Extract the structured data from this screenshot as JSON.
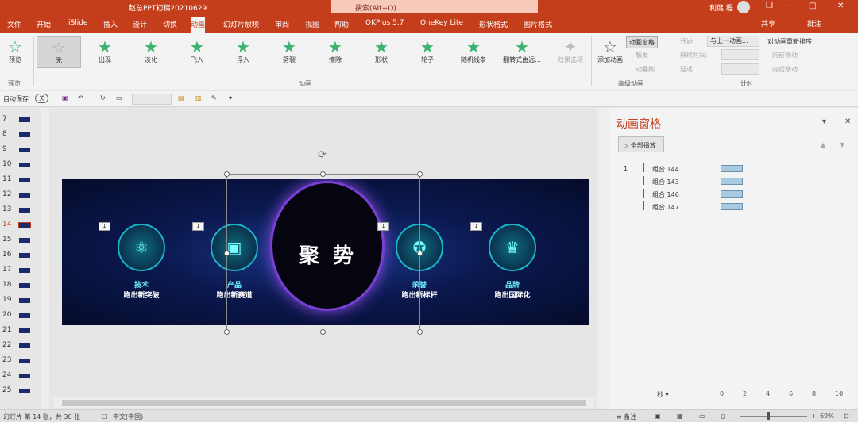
{
  "title_bar": {
    "document": "赵总PPT初稿20210629",
    "search_placeholder": "搜索(Alt+Q)",
    "user": "利健 程",
    "minimize": "—",
    "restore": "❐",
    "maximize": "□",
    "close": "✕"
  },
  "tabs": [
    "文件",
    "开始",
    "iSlide",
    "插入",
    "设计",
    "切换",
    "动画",
    "幻灯片放映",
    "审阅",
    "视图",
    "帮助",
    "OKPlus 5.7",
    "OneKey Lite",
    "形状格式",
    "图片格式"
  ],
  "active_tab": "动画",
  "share": "共享",
  "comments": "批注",
  "ribbon": {
    "preview": "预览",
    "preview_group": "预览",
    "animations": [
      "无",
      "出现",
      "淡化",
      "飞入",
      "浮入",
      "劈裂",
      "擦除",
      "形状",
      "轮子",
      "随机线条",
      "翻转式由远..."
    ],
    "selected_animation": "无",
    "effect_options": "效果选项",
    "animation_group": "动画",
    "add_animation": "添加动画",
    "animation_pane": "动画窗格",
    "trigger": "触发",
    "animation_painter": "动画刷",
    "advanced_group": "高级动画",
    "start_label": "开始:",
    "start_value": "与上一动画...",
    "duration_label": "持续时间:",
    "delay_label": "延迟:",
    "reorder": "对动画重新排序",
    "move_earlier": "向前移动",
    "move_later": "向后移动",
    "timing_group": "计时"
  },
  "qat": {
    "autosave": "自动保存",
    "autosave_state": "关"
  },
  "slides": [
    {
      "num": "7"
    },
    {
      "num": "8"
    },
    {
      "num": "9"
    },
    {
      "num": "10"
    },
    {
      "num": "11"
    },
    {
      "num": "12"
    },
    {
      "num": "13"
    },
    {
      "num": "14"
    },
    {
      "num": "15"
    },
    {
      "num": "16"
    },
    {
      "num": "17"
    },
    {
      "num": "18"
    },
    {
      "num": "19"
    },
    {
      "num": "20"
    },
    {
      "num": "21"
    },
    {
      "num": "22"
    },
    {
      "num": "23"
    },
    {
      "num": "24"
    },
    {
      "num": "25"
    }
  ],
  "current_slide": "14",
  "slide_content": {
    "center_text": "聚 势",
    "features": [
      {
        "title": "技术",
        "subtitle": "跑出新突破",
        "icon": "atom-icon",
        "glyph": "⚛",
        "tag": "1"
      },
      {
        "title": "产品",
        "subtitle": "跑出新赛道",
        "icon": "machine-icon",
        "glyph": "▣",
        "tag": "1"
      },
      {
        "title": "荣誉",
        "subtitle": "跑出新标杆",
        "icon": "medal-icon",
        "glyph": "✪",
        "tag": "1"
      },
      {
        "title": "品牌",
        "subtitle": "跑出国际化",
        "icon": "crown-icon",
        "glyph": "♛",
        "tag": "1"
      }
    ]
  },
  "animation_pane": {
    "title": "动画窗格",
    "play_all": "全部播放",
    "items": [
      {
        "order": "1",
        "label": "组合 144"
      },
      {
        "order": "",
        "label": "组合 143"
      },
      {
        "order": "",
        "label": "组合 146"
      },
      {
        "order": "",
        "label": "组合 147"
      }
    ],
    "time_unit": "秒",
    "timeline_ticks": [
      "0",
      "2",
      "4",
      "6",
      "8",
      "10"
    ]
  },
  "status_bar": {
    "slide_info": "幻灯片 第 14 张，共 30 张",
    "language": "中文(中国)",
    "notes": "备注",
    "zoom": "69%"
  }
}
